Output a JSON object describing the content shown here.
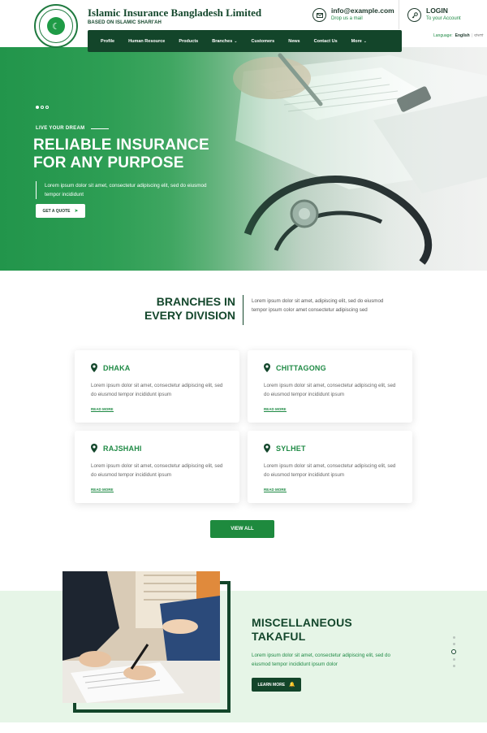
{
  "header": {
    "brand_title": "Islamic Insurance Bangladesh Limited",
    "brand_subtitle": "BASED ON ISLAMIC SHARI'AH",
    "email": "info@example.com",
    "email_sub": "Drop us a mail",
    "login": "LOGIN",
    "login_sub": "To your Account",
    "language_label": "Language:",
    "language_en": "English",
    "language_bn": "বাংলা"
  },
  "nav": {
    "items": [
      {
        "label": "Profile"
      },
      {
        "label": "Human Resource"
      },
      {
        "label": "Products"
      },
      {
        "label": "Branches",
        "dropdown": true
      },
      {
        "label": "Customers"
      },
      {
        "label": "News"
      },
      {
        "label": "Contact Us"
      },
      {
        "label": "More",
        "dropdown": true
      }
    ]
  },
  "hero": {
    "eyebrow": "LIVE YOUR DREAM",
    "title_line1": "RELIABLE INSURANCE",
    "title_line2": "FOR ANY PURPOSE",
    "text": "Lorem ipsum dolor sit amet, consectetur adipiscing elit, sed do eiusmod tempor incididunt",
    "button": "GET A QUOTE",
    "slides": 3,
    "active_slide": 1
  },
  "branches": {
    "title_line1": "BRANCHES IN",
    "title_line2": "EVERY DIVISION",
    "text": "Lorem ipsum dolor sit amet, adipiscing elit, sed do eiusmod tempor ipsum color amet consectetur adipiscing sed",
    "cards": [
      {
        "name": "DHAKA",
        "text": "Lorem ipsum dolor sit amet, consectetur adipiscing elit, sed do eiusmod tempor incididunt ipsum",
        "link": "READ MORE"
      },
      {
        "name": "CHITTAGONG",
        "text": "Lorem ipsum dolor sit amet, consectetur adipiscing elit, sed do eiusmod tempor incididunt ipsum",
        "link": "READ MORE"
      },
      {
        "name": "RAJSHAHI",
        "text": "Lorem ipsum dolor sit amet, consectetur adipiscing elit, sed do eiusmod tempor incididunt ipsum",
        "link": "READ MORE"
      },
      {
        "name": "SYLHET",
        "text": "Lorem ipsum dolor sit amet, consectetur adipiscing elit, sed do eiusmod tempor incididunt ipsum",
        "link": "READ MORE"
      }
    ],
    "view_all": "VIEW ALL"
  },
  "misc": {
    "title_line1": "MISCELLANEOUS",
    "title_line2": "TAKAFUL",
    "text": "Lorem ipsum dolor sit amet, consectetur adipiscing elit, sed do eiusmod tempor incididunt ipsum dolor",
    "button": "LEARN MORE",
    "slides": 5,
    "active_slide": 3
  },
  "colors": {
    "primary_dark": "#13452a",
    "primary": "#1e8a3e",
    "accent": "#1f9b46",
    "misc_bg": "#e6f5e7"
  }
}
